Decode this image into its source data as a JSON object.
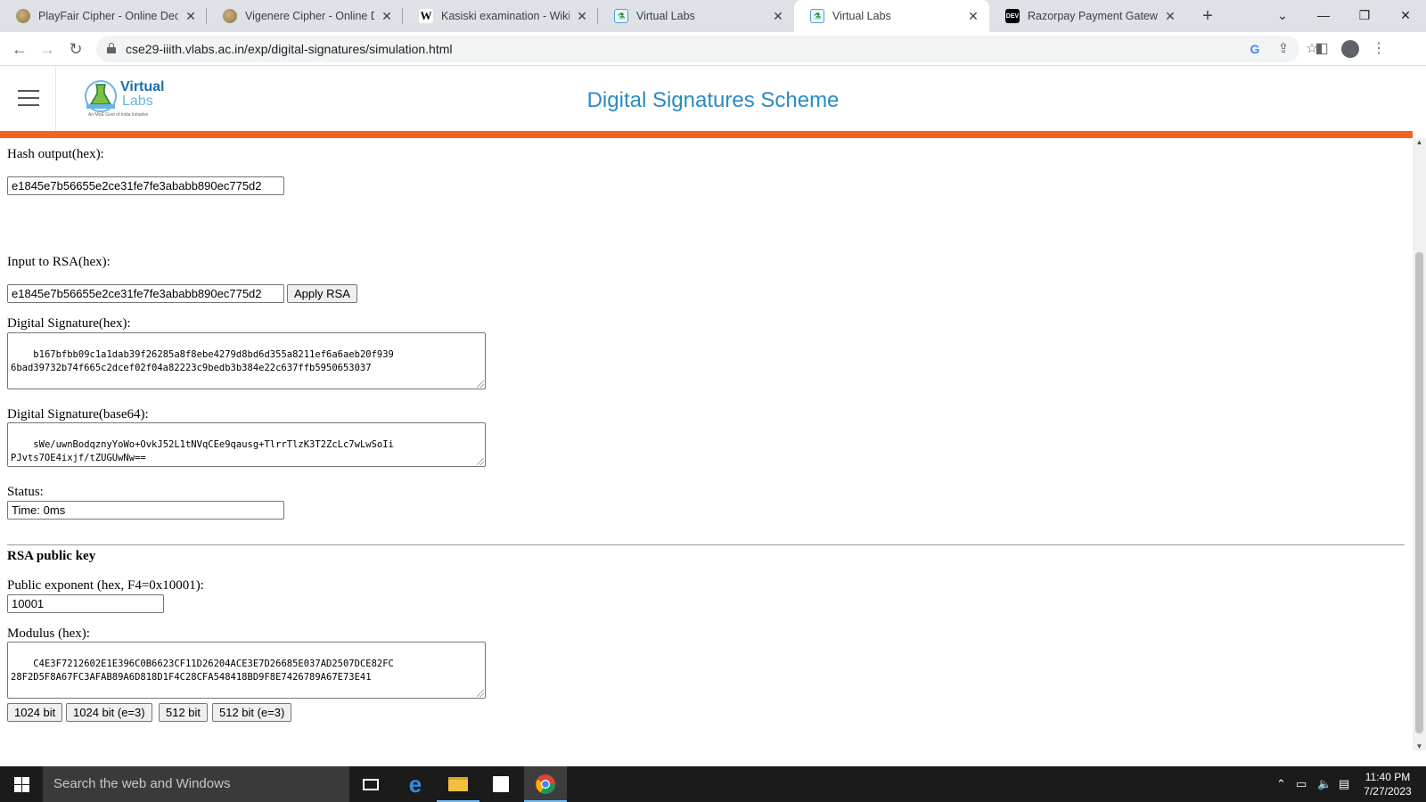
{
  "browser": {
    "tabs": [
      {
        "title": "PlayFair Cipher - Online Deco",
        "favicon": "cookie-icon"
      },
      {
        "title": "Vigenere Cipher - Online Dec",
        "favicon": "cookie-icon"
      },
      {
        "title": "Kasiski examination - Wikipe",
        "favicon": "wikipedia-icon",
        "favicon_text": "W"
      },
      {
        "title": "Virtual Labs",
        "favicon": "virtual-labs-icon"
      },
      {
        "title": "Virtual Labs",
        "favicon": "virtual-labs-icon",
        "active": true
      },
      {
        "title": "Razorpay Payment Gateway I",
        "favicon": "dev-icon",
        "favicon_text": "DEV"
      }
    ],
    "url": "cse29-iiith.vlabs.ac.in/exp/digital-signatures/simulation.html"
  },
  "site": {
    "logo_line1": "Virtual",
    "logo_line2": "Labs",
    "logo_tagline": "An MoE Govt of India Initiative",
    "title": "Digital Signatures Scheme",
    "accent_color": "#f26322",
    "title_color": "#2c8ac2"
  },
  "form": {
    "hash_label": "Hash output(hex):",
    "hash_value": "e1845e7b56655e2ce31fe7fe3ababb890ec775d2",
    "rsa_input_label": "Input to RSA(hex):",
    "rsa_input_value": "e1845e7b56655e2ce31fe7fe3ababb890ec775d2",
    "apply_rsa_label": "Apply RSA",
    "sig_hex_label": "Digital Signature(hex):",
    "sig_hex_value": "b167bfbb09c1a1dab39f26285a8f8ebe4279d8bd6d355a8211ef6a6aeb20f939\n6bad39732b74f665c2dcef02f04a82223c9bedb3b384e22c637ffb5950653037",
    "sig_b64_label": "Digital Signature(base64):",
    "sig_b64_value": "sWe/uwnBodqznyYoWo+OvkJ52L1tNVqCEe9qausg+TlrrTlzK3T2ZcLc7wLwSoIi\nPJvts7OE4ixjf/tZUGUwNw==",
    "status_label": "Status:",
    "status_value": "Time: 0ms",
    "public_key_heading": "RSA public key",
    "exponent_label": "Public exponent (hex, F4=0x10001):",
    "exponent_value": "10001",
    "modulus_label": "Modulus (hex):",
    "modulus_value": "C4E3F7212602E1E396C0B6623CF11D26204ACE3E7D26685E037AD2507DCE82FC\n28F2D5F8A67FC3AFAB89A6D818D1F4C28CFA548418BD9F8E7426789A67E73E41",
    "key_buttons": [
      "1024 bit",
      "1024 bit (e=3)",
      "512 bit",
      "512 bit (e=3)"
    ]
  },
  "taskbar": {
    "search_placeholder": "Search the web and Windows",
    "time": "11:40 PM",
    "date": "7/27/2023"
  }
}
